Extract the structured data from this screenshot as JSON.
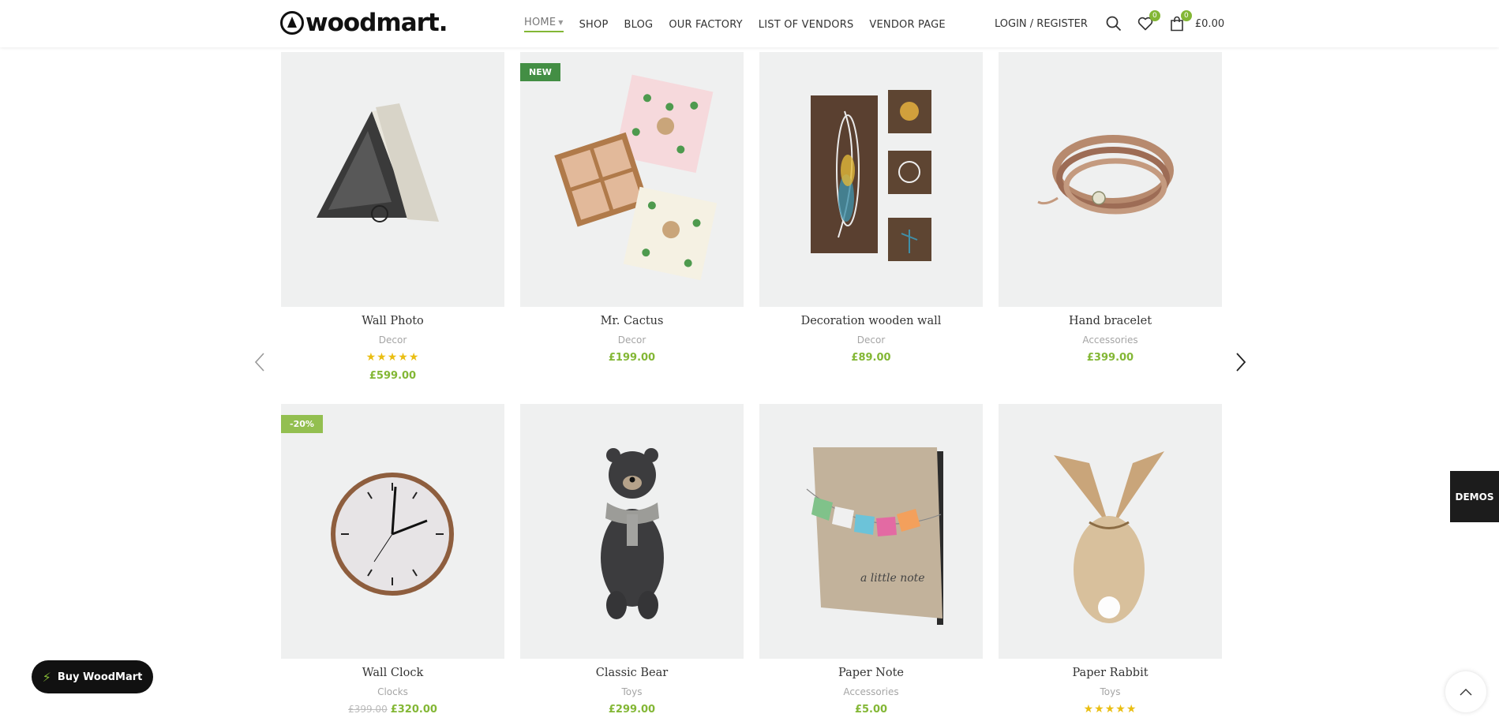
{
  "header": {
    "logo_text": "woodmart.",
    "nav": [
      {
        "label": "HOME",
        "active": true
      },
      {
        "label": "SHOP"
      },
      {
        "label": "BLOG"
      },
      {
        "label": "OUR FACTORY"
      },
      {
        "label": "LIST OF VENDORS"
      },
      {
        "label": "VENDOR PAGE"
      }
    ],
    "login_label": "LOGIN / REGISTER",
    "wishlist_count": "0",
    "cart_count": "0",
    "cart_total": "£0.00"
  },
  "products": [
    {
      "title": "Wall Photo",
      "category": "Decor",
      "price": "£599.00",
      "rating": 5,
      "stars": "★★★★★"
    },
    {
      "title": "Mr. Cactus",
      "category": "Decor",
      "price": "£199.00",
      "label": "NEW"
    },
    {
      "title": "Decoration wooden wall",
      "category": "Decor",
      "price": "£89.00"
    },
    {
      "title": "Hand bracelet",
      "category": "Accessories",
      "price": "£399.00"
    },
    {
      "title": "Wall Clock",
      "category": "Clocks",
      "old_price": "£399.00",
      "price": "£320.00",
      "label": "-20%"
    },
    {
      "title": "Classic Bear",
      "category": "Toys",
      "price": "£299.00"
    },
    {
      "title": "Paper Note",
      "category": "Accessories",
      "price": "£5.00"
    },
    {
      "title": "Paper Rabbit",
      "category": "Toys",
      "price": "",
      "rating": 5,
      "stars": "★★★★★"
    }
  ],
  "buy_button_label": "Buy WoodMart",
  "demos_label": "DEMOS",
  "colors": {
    "accent": "#83b735",
    "new_label": "#438e44",
    "star": "#eabe12"
  },
  "icons": [
    "search-icon",
    "heart-icon",
    "cart-icon",
    "chevron-left-icon",
    "chevron-right-icon",
    "bolt-icon",
    "chevron-up-icon"
  ]
}
